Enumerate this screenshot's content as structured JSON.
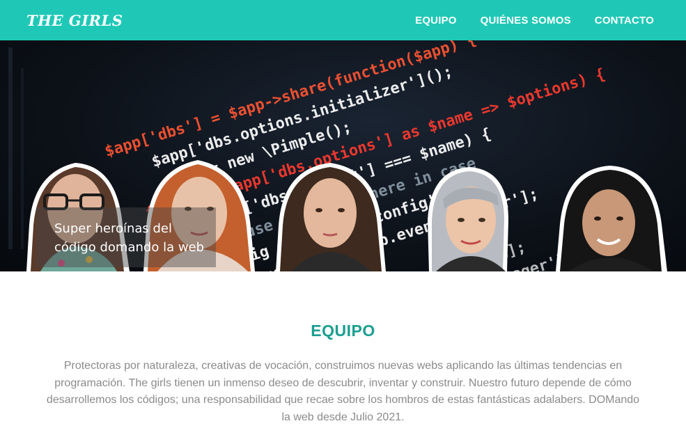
{
  "navbar": {
    "brand": "THE GIRLS",
    "links": [
      {
        "label": "EQUIPO"
      },
      {
        "label": "QUIÉNES SOMOS"
      },
      {
        "label": "CONTACTO"
      }
    ],
    "background_color": "#1fc8b6"
  },
  "hero": {
    "tagline": "Super heroínas del código domando la web",
    "code_lines": [
      {
        "text": "$app['dbs'] = $app->share(function($app) {",
        "color": "#ff5533"
      },
      {
        "text": "$app['dbs.options.initializer']();",
        "color": "#ffffff"
      },
      {
        "text": "$dbs = new \\Pimple();",
        "color": "#ffffff"
      },
      {
        "text": "foreach ($app['dbs.options'] as $name => $options) {",
        "color": "#ff3b30"
      },
      {
        "text": "if ($app['dbs.default'] === $name) {",
        "color": "#ffffff"
      },
      {
        "text": "// we use shortcuts here in case",
        "color": "#8a9aa8"
      },
      {
        "text": "$config = $app['db.config'];",
        "color": "#ffffff"
      },
      {
        "text": "$manager = $app['db.event_manager'];",
        "color": "#ffffff"
      },
      {
        "text": "} else {",
        "color": "#ff3b30"
      },
      {
        "text": "$config = $app['configs'][$name];",
        "color": "#ffffff"
      },
      {
        "text": "$manager = $app['dbs.event_manager'][$name];",
        "color": "#ffffff"
      }
    ],
    "photos": [
      {
        "name": "team-member-1"
      },
      {
        "name": "team-member-2"
      },
      {
        "name": "team-member-3"
      },
      {
        "name": "team-member-4"
      },
      {
        "name": "team-member-5"
      }
    ]
  },
  "team_section": {
    "title": "EQUIPO",
    "description": "Protectoras por naturaleza, creativas de vocación, construimos nuevas webs aplicando las últimas tendencias en programación. The girls tienen un inmenso deseo de descubrir, inventar y construir. Nuestro futuro depende de cómo desarrollemos los códigos; una responsabilidad que recae sobre los hombros de estas fantásticas adalabers. DOMando la web desde Julio 2021.",
    "title_color": "#1a9e90"
  }
}
